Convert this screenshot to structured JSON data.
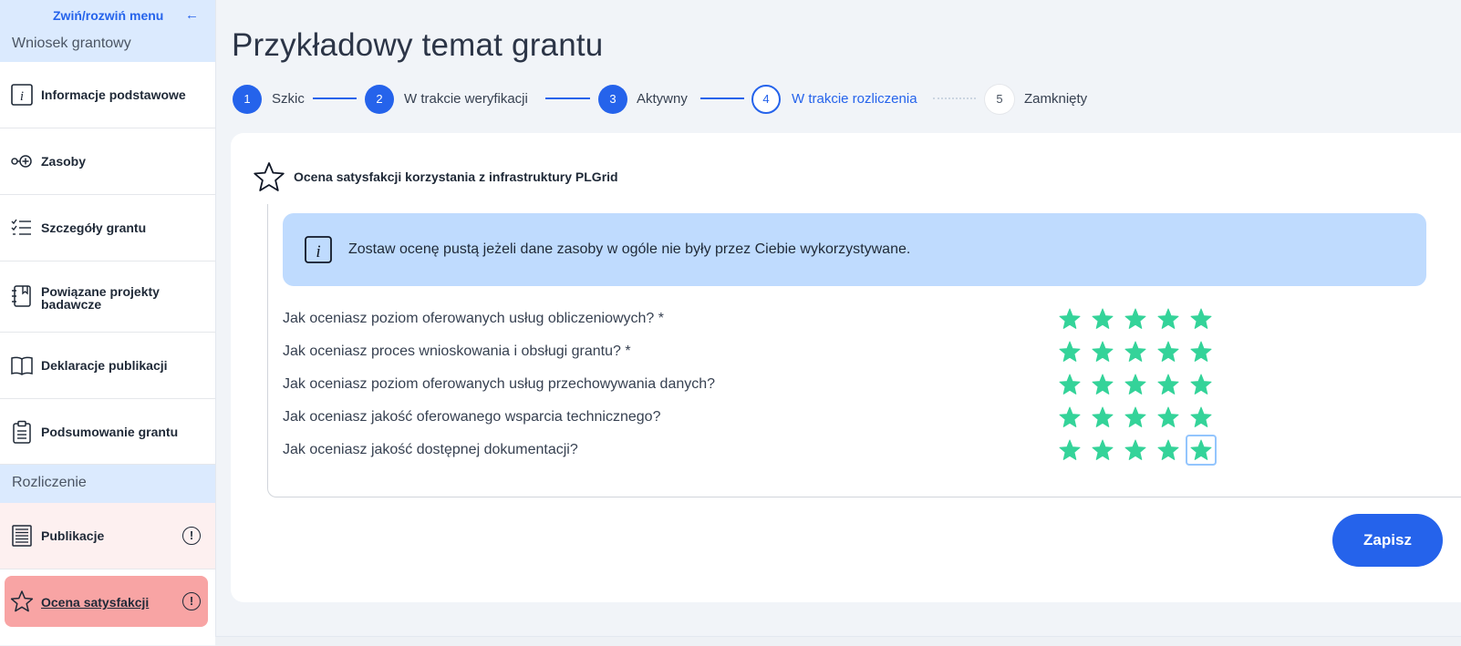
{
  "sidebar": {
    "collapse_label": "Zwiń/rozwiń menu",
    "collapse_arrow": "←",
    "section_grant": "Wniosek grantowy",
    "items": [
      {
        "label": "Informacje podstawowe",
        "icon": "info-icon"
      },
      {
        "label": "Zasoby",
        "icon": "resources-icon"
      },
      {
        "label": "Szczegóły grantu",
        "icon": "checklist-icon"
      },
      {
        "label": "Powiązane projekty badawcze",
        "icon": "notebook-icon"
      },
      {
        "label": "Deklaracje publikacji",
        "icon": "book-icon"
      },
      {
        "label": "Podsumowanie grantu",
        "icon": "clipboard-icon"
      }
    ],
    "section_settlement": "Rozliczenie",
    "settlement_items": [
      {
        "label": "Publikacje",
        "icon": "document-list-icon",
        "alert": "!"
      },
      {
        "label": "Ocena satysfakcji",
        "icon": "star-outline-icon",
        "alert": "!",
        "active": true
      }
    ]
  },
  "header": {
    "title": "Przykładowy temat grantu"
  },
  "stepper": {
    "steps": [
      {
        "number": "1",
        "label": "Szkic",
        "state": "done"
      },
      {
        "number": "2",
        "label": "W trakcie weryfikacji",
        "state": "done"
      },
      {
        "number": "3",
        "label": "Aktywny",
        "state": "done"
      },
      {
        "number": "4",
        "label": "W trakcie rozliczenia",
        "state": "current"
      },
      {
        "number": "5",
        "label": "Zamknięty",
        "state": "future"
      }
    ]
  },
  "survey": {
    "title": "Ocena satysfakcji korzystania z infrastruktury PLGrid",
    "info": "Zostaw ocenę pustą jeżeli dane zasoby w ogóle nie były przez Ciebie wykorzystywane.",
    "questions": [
      {
        "label": "Jak oceniasz poziom oferowanych usług obliczeniowych? *",
        "rating": 5,
        "max": 5
      },
      {
        "label": "Jak oceniasz proces wnioskowania i obsługi grantu? *",
        "rating": 5,
        "max": 5
      },
      {
        "label": "Jak oceniasz poziom oferowanych usług przechowywania danych?",
        "rating": 5,
        "max": 5
      },
      {
        "label": "Jak oceniasz jakość oferowanego wsparcia technicznego?",
        "rating": 5,
        "max": 5
      },
      {
        "label": "Jak oceniasz jakość dostępnej dokumentacji?",
        "rating": 5,
        "max": 5
      }
    ],
    "save_label": "Zapisz"
  },
  "colors": {
    "accent": "#2563eb",
    "star": "#34d399",
    "info_bg": "#bfdbfe",
    "active_nav": "#f8a4a4"
  }
}
